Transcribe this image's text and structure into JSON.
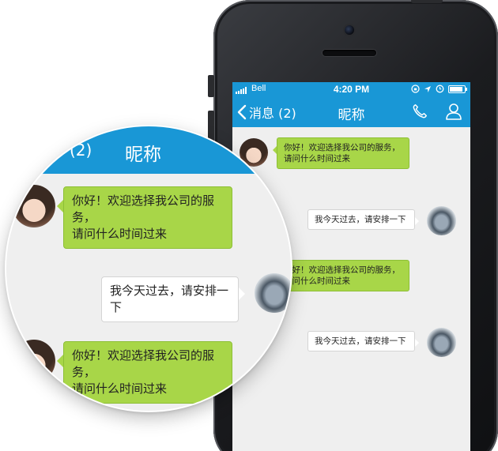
{
  "status": {
    "carrier": "Bell",
    "time": "4:20 PM"
  },
  "nav": {
    "back_label": "消息 (2)",
    "title": "昵称"
  },
  "messages": [
    {
      "side": "received",
      "text1": "你好！欢迎选择我公司的服务，",
      "text2": "请问什么时间过来"
    },
    {
      "side": "sent",
      "text": "我今天过去，请安排一下"
    },
    {
      "side": "received",
      "text1": "你好！欢迎选择我公司的服务，",
      "text2": "请问什么时间过来"
    },
    {
      "side": "sent",
      "text": "我今天过去，请安排一下"
    }
  ],
  "magnifier": {
    "back_label": "(2)",
    "title": "昵称",
    "messages": [
      {
        "side": "received",
        "text1": "你好！欢迎选择我公司的服务，",
        "text2": "请问什么时间过来"
      },
      {
        "side": "sent",
        "text": "我今天过去，请安排一下"
      },
      {
        "side": "received",
        "text1": "你好！欢迎选择我公司的服务，",
        "text2": "请问什么时间过来"
      }
    ]
  },
  "icons": {
    "signal": "signal-bars-icon",
    "lock": "rotation-lock-icon",
    "location": "location-arrow-icon",
    "battery": "battery-icon",
    "back": "chevron-left-icon",
    "call": "phone-icon",
    "contact": "user-icon"
  },
  "colors": {
    "accent": "#1997d6",
    "received_bubble": "#a8d648",
    "sent_bubble": "#ffffff",
    "background": "#efefef"
  }
}
